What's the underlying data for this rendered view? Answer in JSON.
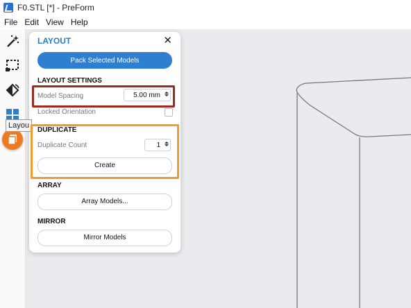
{
  "window": {
    "title": "F0.STL [*] - PreForm"
  },
  "menu": [
    "File",
    "Edit",
    "View",
    "Help"
  ],
  "toolbar": {
    "tools": [
      "magic-wand-icon",
      "select-box-icon",
      "orient-icon",
      "layout-icon"
    ],
    "tooltip": "Layou"
  },
  "panel": {
    "title": "LAYOUT",
    "close": "✕",
    "pack_button": "Pack Selected Models",
    "layout_settings": {
      "header": "LAYOUT SETTINGS",
      "model_spacing_label": "Model Spacing",
      "model_spacing_value": "5.00 mm",
      "locked_orientation_label": "Locked Orientation"
    },
    "duplicate": {
      "header": "DUPLICATE",
      "count_label": "Duplicate Count",
      "count_value": "1",
      "create_button": "Create"
    },
    "array": {
      "header": "ARRAY",
      "button": "Array Models..."
    },
    "mirror": {
      "header": "MIRROR",
      "button": "Mirror Models"
    }
  },
  "colors": {
    "accent": "#2f7fd0",
    "highlight_red": "#9e2a1e",
    "highlight_orange": "#f29a2e",
    "fab": "#f07a22"
  }
}
